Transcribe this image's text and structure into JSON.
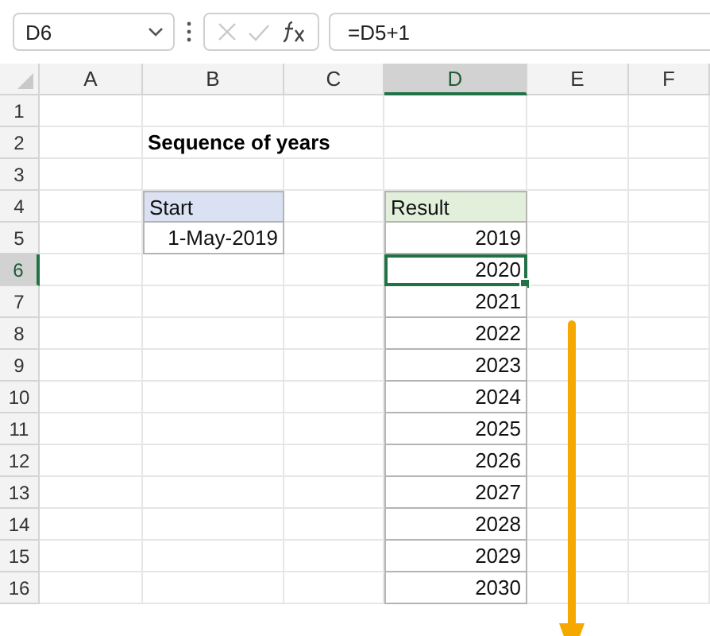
{
  "formula_bar": {
    "name_box": "D6",
    "formula": "=D5+1"
  },
  "columns": [
    {
      "label": "A",
      "selected": false
    },
    {
      "label": "B",
      "selected": false
    },
    {
      "label": "C",
      "selected": false
    },
    {
      "label": "D",
      "selected": true
    },
    {
      "label": "E",
      "selected": false
    },
    {
      "label": "F",
      "selected": false
    }
  ],
  "rows": [
    {
      "number": "1",
      "selected": false
    },
    {
      "number": "2",
      "selected": false
    },
    {
      "number": "3",
      "selected": false
    },
    {
      "number": "4",
      "selected": false
    },
    {
      "number": "5",
      "selected": false
    },
    {
      "number": "6",
      "selected": true
    },
    {
      "number": "7",
      "selected": false
    },
    {
      "number": "8",
      "selected": false
    },
    {
      "number": "9",
      "selected": false
    },
    {
      "number": "10",
      "selected": false
    },
    {
      "number": "11",
      "selected": false
    },
    {
      "number": "12",
      "selected": false
    },
    {
      "number": "13",
      "selected": false
    },
    {
      "number": "14",
      "selected": false
    },
    {
      "number": "15",
      "selected": false
    },
    {
      "number": "16",
      "selected": false
    }
  ],
  "title": "Sequence of years",
  "start_table": {
    "header": "Start",
    "color": "#d9e1f2",
    "values": [
      {
        "text": "1-May-2019",
        "selected": false
      }
    ]
  },
  "result_table": {
    "header": "Result",
    "color": "#e2efda",
    "values": [
      {
        "text": "2019",
        "selected": false
      },
      {
        "text": "2020",
        "selected": true
      },
      {
        "text": "2021",
        "selected": false
      },
      {
        "text": "2022",
        "selected": false
      },
      {
        "text": "2023",
        "selected": false
      },
      {
        "text": "2024",
        "selected": false
      },
      {
        "text": "2025",
        "selected": false
      },
      {
        "text": "2026",
        "selected": false
      },
      {
        "text": "2027",
        "selected": false
      },
      {
        "text": "2028",
        "selected": false
      },
      {
        "text": "2029",
        "selected": false
      },
      {
        "text": "2030",
        "selected": false
      }
    ]
  }
}
